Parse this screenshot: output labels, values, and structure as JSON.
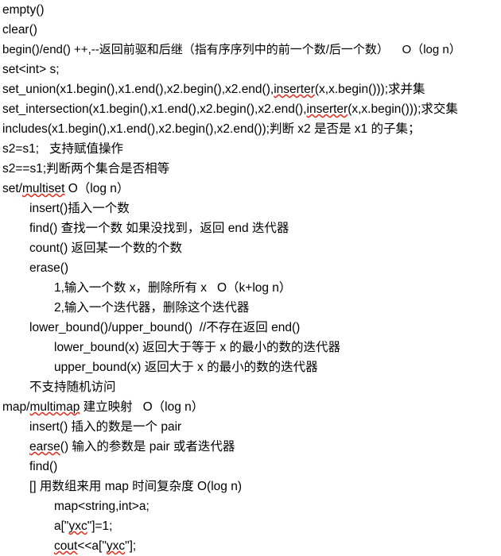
{
  "document": {
    "type": "notes",
    "language": "zh-CN + C++",
    "background_color": "#ffffff",
    "text_color": "#000000",
    "spellcheck_underline_color": "#e03020",
    "lines": [
      {
        "indent": 0,
        "text": "empty()"
      },
      {
        "indent": 0,
        "text": "clear()"
      },
      {
        "indent": 0,
        "text": "begin()/end() ++,--返回前驱和后继（指有序序列中的前一个数/后一个数）    O（log n）"
      },
      {
        "indent": 0,
        "text": "set<int> s;"
      },
      {
        "indent": 0,
        "text": "set_union(x1.begin(),x1.end(),x2.begin(),x2.end(),inserter(x,x.begin()));求并集"
      },
      {
        "indent": 0,
        "text": "set_intersection(x1.begin(),x1.end(),x2.begin(),x2.end(),inserter(x,x.begin()));求交集"
      },
      {
        "indent": 0,
        "text": "includes(x1.begin(),x1.end(),x2.begin(),x2.end());判断 x2 是否是 x1 的子集；"
      },
      {
        "indent": 0,
        "text": "s2=s1;   支持赋值操作"
      },
      {
        "indent": 0,
        "text": "s2==s1;判断两个集合是否相等"
      },
      {
        "indent": 0,
        "text": "set/multiset O（log n）"
      },
      {
        "indent": 1,
        "text": "insert()插入一个数"
      },
      {
        "indent": 1,
        "text": "find() 查找一个数 如果没找到，返回 end 迭代器"
      },
      {
        "indent": 1,
        "text": "count() 返回某一个数的个数"
      },
      {
        "indent": 1,
        "text": "erase()"
      },
      {
        "indent": 2,
        "text": "1,输入一个数 x，删除所有 x   O（k+log n）"
      },
      {
        "indent": 2,
        "text": "2,输入一个迭代器，删除这个迭代器"
      },
      {
        "indent": 1,
        "text": "lower_bound()/upper_bound()  //不存在返回 end()"
      },
      {
        "indent": 2,
        "text": "lower_bound(x) 返回大于等于 x 的最小的数的迭代器"
      },
      {
        "indent": 2,
        "text": "upper_bound(x) 返回大于 x 的最小的数的迭代器"
      },
      {
        "indent": 1,
        "text": "不支持随机访问"
      },
      {
        "indent": 0,
        "text": "map/multimap 建立映射   O（log n）"
      },
      {
        "indent": 1,
        "text": "insert() 插入的数是一个 pair"
      },
      {
        "indent": 1,
        "text": "earse() 输入的参数是 pair 或者迭代器"
      },
      {
        "indent": 1,
        "text": "find()"
      },
      {
        "indent": 1,
        "text": "[] 用数组来用 map 时间复杂度 O(log n)"
      },
      {
        "indent": 2,
        "text": "map<string,int>a;"
      },
      {
        "indent": 2,
        "text": "a[\"yxc\"]=1;"
      },
      {
        "indent": 2,
        "text": "cout<<a[\"yxc\"];"
      }
    ],
    "spellcheck_words": [
      "inserter",
      "multiset",
      "multimap",
      "earse",
      "yxc",
      "cout"
    ]
  }
}
